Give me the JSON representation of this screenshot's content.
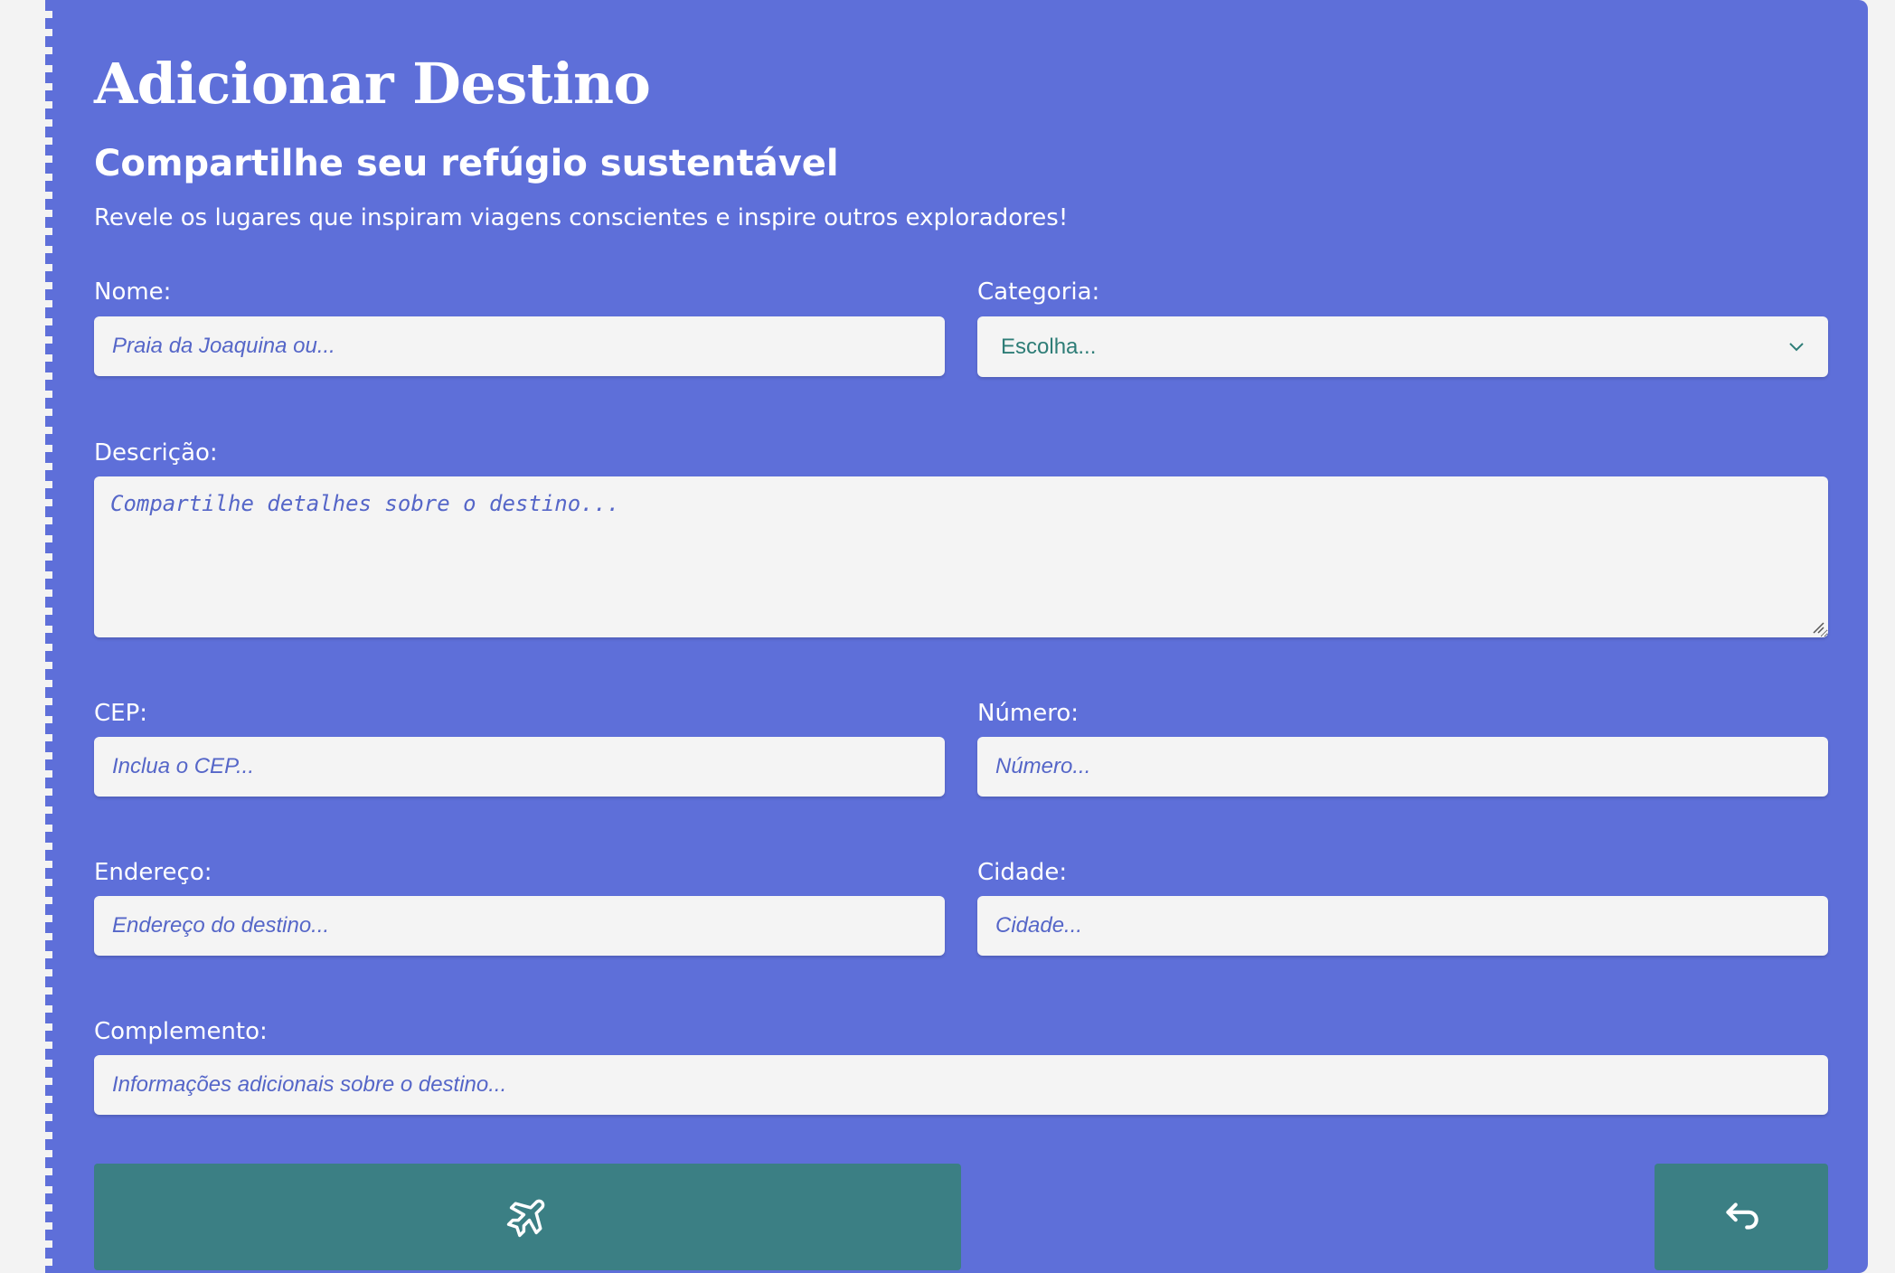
{
  "header": {
    "title": "Adicionar Destino",
    "subtitle": "Compartilhe seu refúgio sustentável",
    "lead": "Revele os lugares que inspiram viagens conscientes e inspire outros exploradores!"
  },
  "form": {
    "nome": {
      "label": "Nome:",
      "placeholder": "Praia da Joaquina ou..."
    },
    "categoria": {
      "label": "Categoria:",
      "selected": "Escolha..."
    },
    "descricao": {
      "label": "Descrição:",
      "placeholder": "Compartilhe detalhes sobre o destino..."
    },
    "cep": {
      "label": "CEP:",
      "placeholder": "Inclua o CEP..."
    },
    "numero": {
      "label": "Número:",
      "placeholder": "Número..."
    },
    "endereco": {
      "label": "Endereço:",
      "placeholder": "Endereço do destino..."
    },
    "cidade": {
      "label": "Cidade:",
      "placeholder": "Cidade..."
    },
    "complemento": {
      "label": "Complemento:",
      "placeholder": "Informações adicionais sobre o destino..."
    }
  },
  "actions": {
    "submit_icon": "airplane-icon",
    "back_icon": "undo-arrow-icon"
  },
  "colors": {
    "card_bg": "#5e6fd9",
    "page_bg": "#f3f3f3",
    "button_bg": "#3b7f84",
    "input_bg": "#f4f4f4",
    "placeholder": "#5566c8",
    "select_text": "#2e7d77"
  }
}
